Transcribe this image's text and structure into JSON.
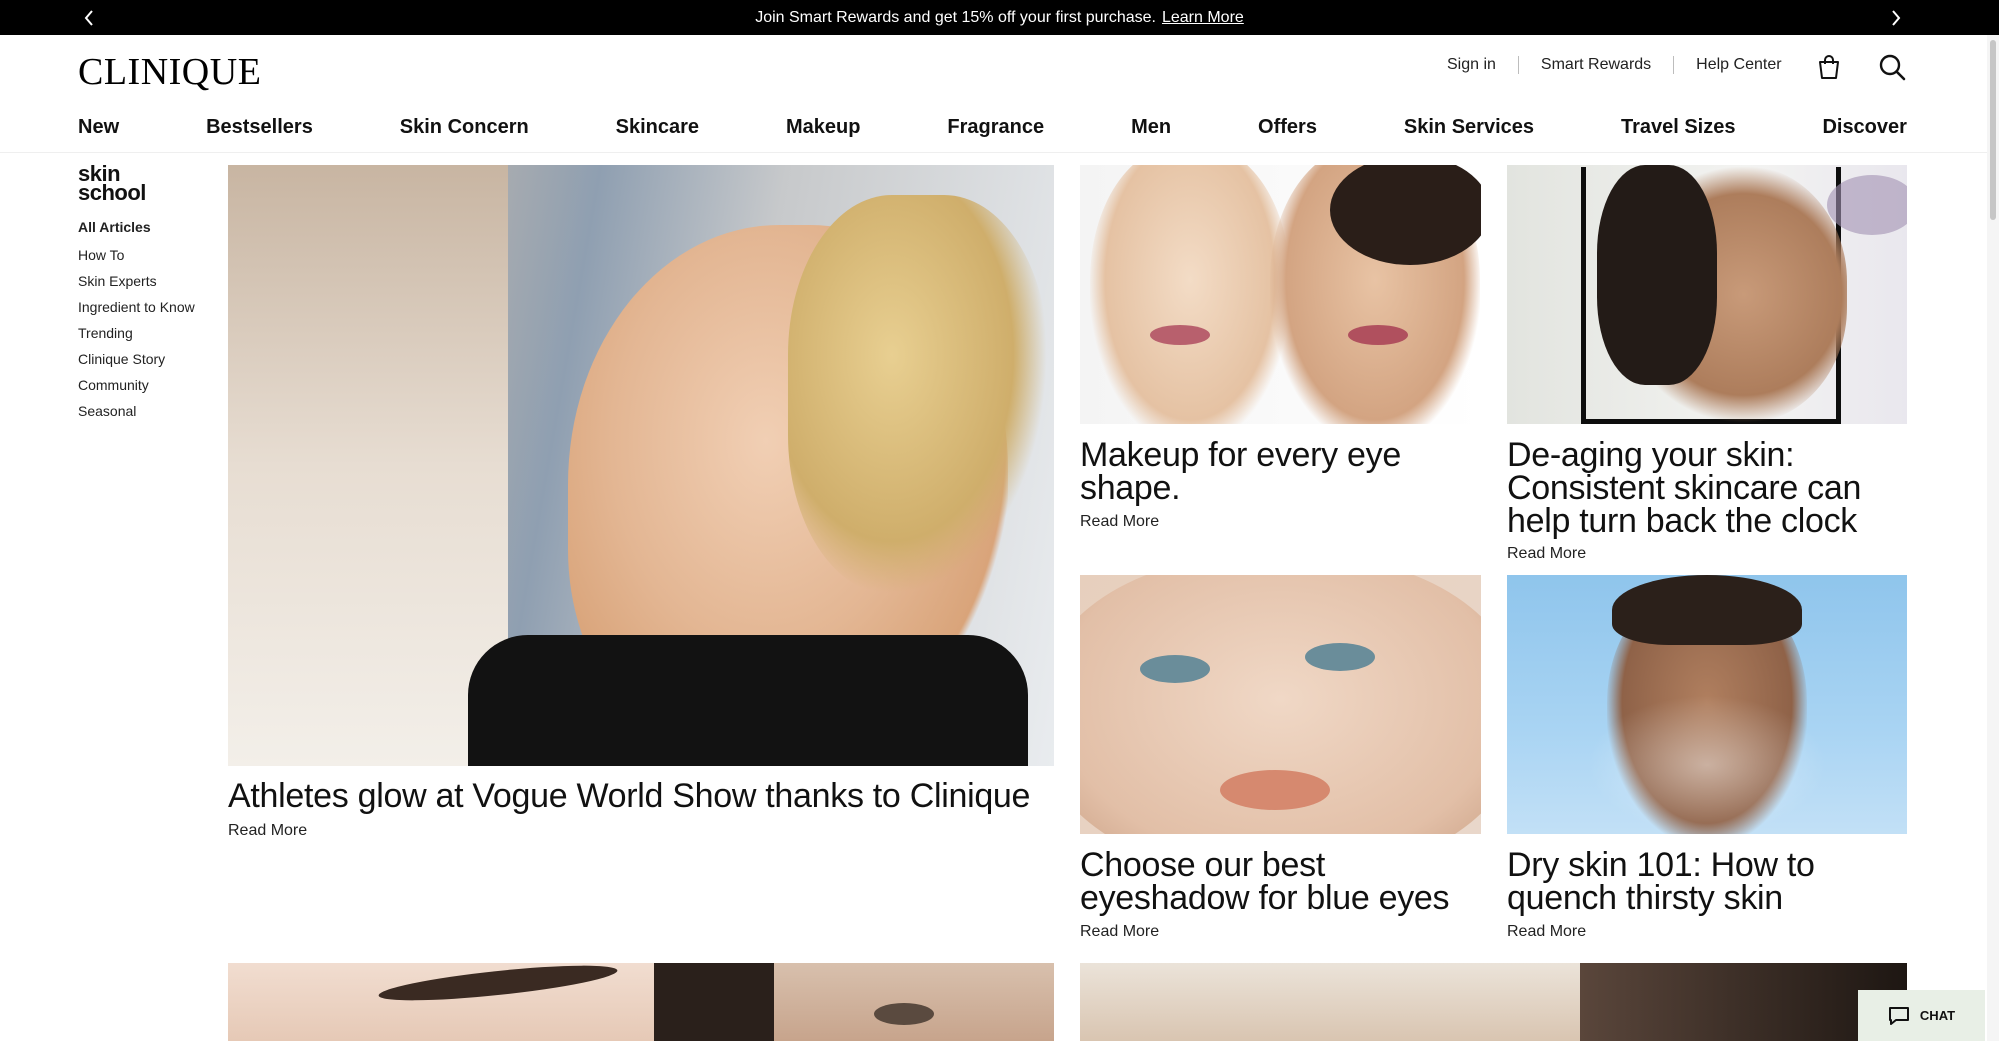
{
  "promo": {
    "message": "Join Smart Rewards and get 15% off your first purchase.",
    "link": "Learn More",
    "prev_icon": "chevron-left-icon",
    "next_icon": "chevron-right-icon"
  },
  "header": {
    "logo": "CLINIQUE",
    "utility": [
      "Sign in",
      "Smart Rewards",
      "Help Center"
    ],
    "bag_icon": "shopping-bag-icon",
    "search_icon": "search-icon"
  },
  "nav": [
    "New",
    "Bestsellers",
    "Skin Concern",
    "Skincare",
    "Makeup",
    "Fragrance",
    "Men",
    "Offers",
    "Skin Services",
    "Travel Sizes",
    "Discover"
  ],
  "sidebar": {
    "logo_line1": "skin",
    "logo_line2": "school",
    "items": [
      "All Articles",
      "How To",
      "Skin Experts",
      "Ingredient to Know",
      "Trending",
      "Clinique Story",
      "Community",
      "Seasonal"
    ]
  },
  "articles": [
    {
      "title": "Athletes glow at Vogue World Show thanks to Clinique",
      "cta": "Read More"
    },
    {
      "title": "Makeup for every eye shape.",
      "cta": "Read More"
    },
    {
      "title": "De-aging your skin: Consistent skincare can help turn back the clock",
      "cta": "Read More"
    },
    {
      "title": "Choose our best eyeshadow for blue eyes",
      "cta": "Read More"
    },
    {
      "title": "Dry skin 101: How to quench thirsty skin",
      "cta": "Read More"
    }
  ],
  "chat": {
    "label": "CHAT",
    "icon": "chat-bubble-icon"
  },
  "colors": {
    "promo_bg": "#000000",
    "chat_bg": "#e8efe6",
    "text": "#111111"
  }
}
